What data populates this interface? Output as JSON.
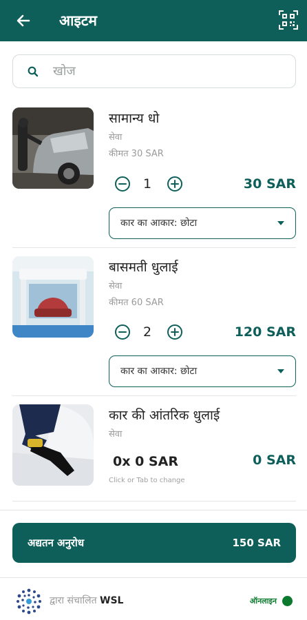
{
  "appbar": {
    "title": "आइटम",
    "back_icon": "arrow-left-icon",
    "qr_icon": "qr-scan-icon",
    "color": "#0e5f5a"
  },
  "search": {
    "placeholder": "खोज",
    "icon": "search-icon"
  },
  "items": [
    {
      "name": "सामान्य धो",
      "type": "सेवा",
      "price_text": "कीमत 30 SAR",
      "quantity": "1",
      "total": "30 SAR",
      "option_value": "कार का आकार: छोटा",
      "image": "car-wash-worker-photo"
    },
    {
      "name": "बासमती धुलाई",
      "type": "सेवा",
      "price_text": "कीमत 60 SAR",
      "quantity": "2",
      "total": "120 SAR",
      "option_value": "कार का आकार: छोटा",
      "image": "automatic-car-wash-photo"
    },
    {
      "name": "कार की आंतरिक धुलाई",
      "type": "सेवा",
      "qty_price": "0x 0 SAR",
      "total": "0 SAR",
      "hint": "Click or Tab to change",
      "image": "car-interior-cleaning-photo"
    }
  ],
  "cta": {
    "label": "अद्यतन अनुरोध",
    "amount": "150 SAR"
  },
  "footer": {
    "powered_by": "द्वारा संचालित",
    "brand": "WSL",
    "status": "ऑनलाइन",
    "status_color": "#0c7a2e"
  }
}
